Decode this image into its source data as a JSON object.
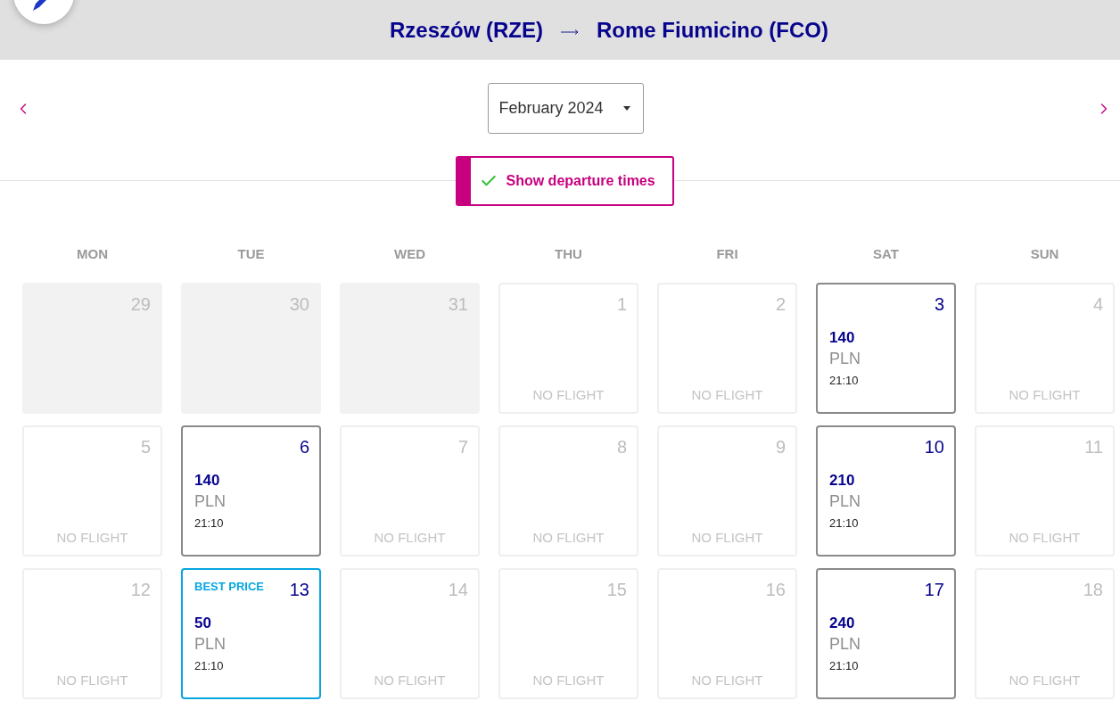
{
  "header": {
    "origin": "Rzeszów (RZE)",
    "destination": "Rome Fiumicino (FCO)"
  },
  "month_picker": {
    "value": "February 2024"
  },
  "toggle": {
    "label": "Show departure times",
    "checked": true
  },
  "weekdays": [
    "MON",
    "TUE",
    "WED",
    "THU",
    "FRI",
    "SAT",
    "SUN"
  ],
  "days": [
    {
      "day": "29",
      "kind": "outside"
    },
    {
      "day": "30",
      "kind": "outside"
    },
    {
      "day": "31",
      "kind": "outside"
    },
    {
      "day": "1",
      "kind": "no_flight",
      "note": "NO FLIGHT"
    },
    {
      "day": "2",
      "kind": "no_flight",
      "note": "NO FLIGHT"
    },
    {
      "day": "3",
      "kind": "flight",
      "price": "140",
      "currency": "PLN",
      "time": "21:10"
    },
    {
      "day": "4",
      "kind": "no_flight",
      "note": "NO FLIGHT"
    },
    {
      "day": "5",
      "kind": "no_flight",
      "note": "NO FLIGHT"
    },
    {
      "day": "6",
      "kind": "flight",
      "price": "140",
      "currency": "PLN",
      "time": "21:10"
    },
    {
      "day": "7",
      "kind": "no_flight",
      "note": "NO FLIGHT"
    },
    {
      "day": "8",
      "kind": "no_flight",
      "note": "NO FLIGHT"
    },
    {
      "day": "9",
      "kind": "no_flight",
      "note": "NO FLIGHT"
    },
    {
      "day": "10",
      "kind": "flight",
      "price": "210",
      "currency": "PLN",
      "time": "21:10"
    },
    {
      "day": "11",
      "kind": "no_flight",
      "note": "NO FLIGHT"
    },
    {
      "day": "12",
      "kind": "no_flight",
      "note": "NO FLIGHT"
    },
    {
      "day": "13",
      "kind": "best_price",
      "badge": "BEST PRICE",
      "price": "50",
      "currency": "PLN",
      "time": "21:10"
    },
    {
      "day": "14",
      "kind": "no_flight",
      "note": "NO FLIGHT"
    },
    {
      "day": "15",
      "kind": "no_flight",
      "note": "NO FLIGHT"
    },
    {
      "day": "16",
      "kind": "no_flight",
      "note": "NO FLIGHT"
    },
    {
      "day": "17",
      "kind": "flight",
      "price": "240",
      "currency": "PLN",
      "time": "21:10"
    },
    {
      "day": "18",
      "kind": "no_flight",
      "note": "NO FLIGHT"
    }
  ]
}
